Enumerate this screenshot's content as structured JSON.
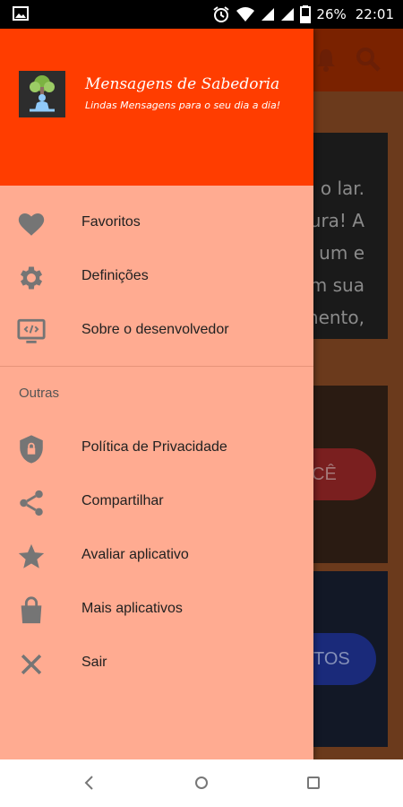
{
  "status_bar": {
    "battery_percent": "26%",
    "time": "22:01"
  },
  "drawer": {
    "header_bg": "#ff3d00",
    "app_title": "Mensagens de Sabedoria",
    "app_subtitle": "Lindas Mensagens para o seu dia a dia!",
    "menu_primary": [
      {
        "label": "Favoritos",
        "icon": "heart-icon"
      },
      {
        "label": "Definições",
        "icon": "gear-icon"
      },
      {
        "label": "Sobre o desenvolvedor",
        "icon": "developer-monitor-icon"
      }
    ],
    "section_title": "Outras",
    "menu_other": [
      {
        "label": "Política de Privacidade",
        "icon": "shield-lock-icon"
      },
      {
        "label": "Compartilhar",
        "icon": "share-icon"
      },
      {
        "label": "Avaliar aplicativo",
        "icon": "star-icon"
      },
      {
        "label": "Mais aplicativos",
        "icon": "shopping-bag-icon"
      },
      {
        "label": "Sair",
        "icon": "close-icon"
      }
    ]
  },
  "background": {
    "quote_lines": [
      "o lar.",
      "ura! A",
      "um e",
      "m sua",
      "mento,"
    ],
    "button1_partial": "CÊ",
    "button2_partial": "TOS"
  }
}
